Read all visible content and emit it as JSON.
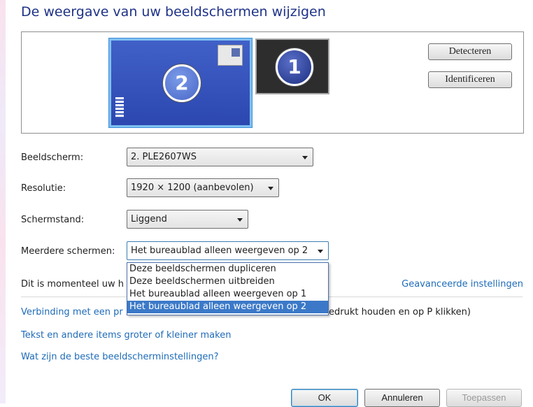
{
  "title": "De weergave van uw beeldschermen wijzigen",
  "preview": {
    "monitor_2_number": "2",
    "monitor_1_number": "1",
    "detect_label": "Detecteren",
    "identify_label": "Identificeren"
  },
  "form": {
    "display": {
      "label": "Beeldscherm:",
      "value": "2. PLE2607WS"
    },
    "resolution": {
      "label": "Resolutie:",
      "value": "1920 × 1200 (aanbevolen)"
    },
    "orientation": {
      "label": "Schermstand:",
      "value": "Liggend"
    },
    "multiple": {
      "label": "Meerdere schermen:",
      "value": "Het bureaublad alleen weergeven op 2",
      "options": [
        "Deze beeldschermen dupliceren",
        "Deze beeldschermen uitbreiden",
        "Het bureaublad alleen weergeven op 1",
        "Het bureaublad alleen weergeven op 2"
      ],
      "selected_index": 3
    }
  },
  "status_text": "Dit is momenteel uw h",
  "advanced_link": "Geavanceerde instellingen",
  "links": {
    "projector": "Verbinding met een pr",
    "projector_tail": "edrukt houden en op P klikken)",
    "text_size": "Tekst en andere items groter of kleiner maken",
    "best_settings": "Wat zijn de beste beeldscherminstellingen?"
  },
  "footer": {
    "ok": "OK",
    "cancel": "Annuleren",
    "apply": "Toepassen"
  }
}
